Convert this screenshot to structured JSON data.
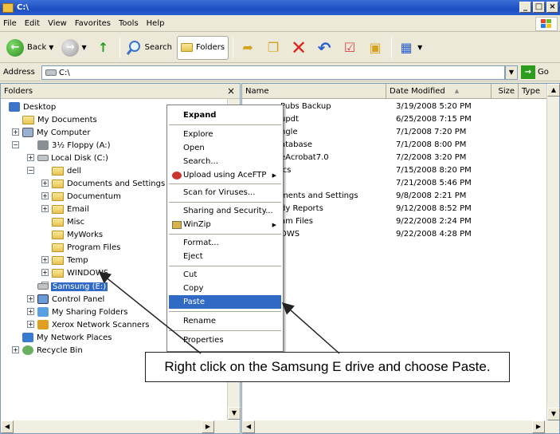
{
  "window": {
    "title": "C:\\"
  },
  "menu": [
    "File",
    "Edit",
    "View",
    "Favorites",
    "Tools",
    "Help"
  ],
  "toolbar": {
    "back_label": "Back",
    "search_label": "Search",
    "folders_label": "Folders"
  },
  "address": {
    "label": "Address",
    "value": "C:\\",
    "go_label": "Go"
  },
  "folders_pane": {
    "title": "Folders",
    "close_glyph": "×",
    "tree": [
      {
        "label": "Desktop",
        "icon": "desktop-icon"
      },
      {
        "label": "My Documents",
        "icon": "folder-icon"
      },
      {
        "label": "My Computer",
        "icon": "computer-icon"
      },
      {
        "label": "3½ Floppy (A:)",
        "icon": "floppy-icon"
      },
      {
        "label": "Local Disk (C:)",
        "icon": "drive-icon"
      },
      {
        "label": "dell",
        "icon": "folder-icon"
      },
      {
        "label": "Documents and Settings",
        "icon": "folder-icon"
      },
      {
        "label": "Documentum",
        "icon": "folder-icon"
      },
      {
        "label": "Email",
        "icon": "folder-icon"
      },
      {
        "label": "Misc",
        "icon": "folder-icon"
      },
      {
        "label": "MyWorks",
        "icon": "folder-icon"
      },
      {
        "label": "Program Files",
        "icon": "folder-icon"
      },
      {
        "label": "Temp",
        "icon": "folder-icon"
      },
      {
        "label": "WINDOWS",
        "icon": "folder-icon"
      },
      {
        "label": "Samsung (E:)",
        "icon": "drive-icon"
      },
      {
        "label": "Control Panel",
        "icon": "control-panel-icon"
      },
      {
        "label": "My Sharing Folders",
        "icon": "sharing-icon"
      },
      {
        "label": "Xerox Network Scanners",
        "icon": "scanner-icon"
      },
      {
        "label": "My Network Places",
        "icon": "network-icon"
      },
      {
        "label": "Recycle Bin",
        "icon": "recycle-bin-icon"
      }
    ]
  },
  "file_list": {
    "columns": {
      "name": "Name",
      "date": "Date Modified",
      "sort_glyph": "▲",
      "size": "Size",
      "type": "Type"
    },
    "rows": [
      {
        "name": "Pubs Backup",
        "date": "3/19/2008 5:20 PM"
      },
      {
        "name": "updt",
        "date": "6/25/2008 7:15 PM"
      },
      {
        "name": "ngle",
        "date": "7/1/2008 7:20 PM"
      },
      {
        "name": "atabase",
        "date": "7/1/2008 8:00 PM"
      },
      {
        "name": "eAcrobat7.0",
        "date": "7/2/2008 3:20 PM"
      },
      {
        "name": "ics",
        "date": "7/15/2008 8:20 PM"
      },
      {
        "name": "",
        "date": "7/21/2008 5:46 PM"
      },
      {
        "name": "ments and Settings",
        "date": "9/8/2008 2:21 PM"
      },
      {
        "name": "dy Reports",
        "date": "9/12/2008 8:52 PM"
      },
      {
        "name": "am Files",
        "date": "9/22/2008 2:24 PM"
      },
      {
        "name": "OWS",
        "date": "9/22/2008 4:28 PM"
      }
    ]
  },
  "context_menu": {
    "items": [
      {
        "label": "Expand",
        "bold": true
      },
      {
        "label": "Explore"
      },
      {
        "label": "Open"
      },
      {
        "label": "Search..."
      },
      {
        "label": "Upload using AceFTP",
        "submenu": true
      },
      {
        "label": "Scan for Viruses..."
      },
      {
        "label": "Sharing and Security..."
      },
      {
        "label": "WinZip",
        "submenu": true
      },
      {
        "label": "Format..."
      },
      {
        "label": "Eject"
      },
      {
        "label": "Cut"
      },
      {
        "label": "Copy"
      },
      {
        "label": "Paste",
        "highlighted": true
      },
      {
        "label": "Rename"
      },
      {
        "label": "Properties"
      }
    ],
    "submenu_glyph": "▶"
  },
  "callout": {
    "text": "Right click on the Samsung E drive and choose Paste."
  },
  "colors": {
    "selection": "#316ac5",
    "titlebar": "#1c4fc2",
    "go_green": "#2b9c1d"
  }
}
